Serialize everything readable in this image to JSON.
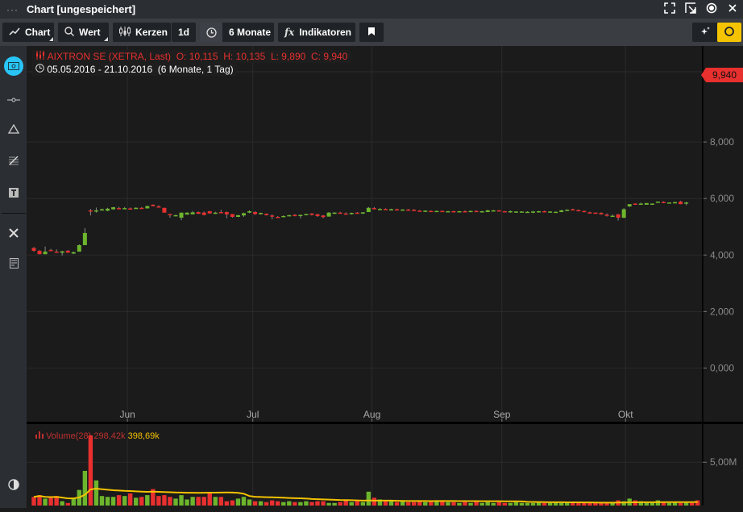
{
  "window": {
    "title": "Chart [ungespeichert]",
    "menu_icon": "ellipsis-icon"
  },
  "toolbar": {
    "chart": "Chart",
    "wert": "Wert",
    "kerzen": "Kerzen",
    "interval": "1d",
    "range": "6 Monate",
    "indikatoren": "Indikatoren"
  },
  "legend": {
    "instrument": "AIXTRON SE (XETRA, Last)",
    "open": "O: 10,115",
    "high": "H: 10,135",
    "low": "L: 9,890",
    "close": "C: 9,940",
    "daterange": "05.05.2016 - 21.10.2016",
    "span": "(6 Monate, 1 Tag)"
  },
  "price_label": "9,940",
  "volume_legend": {
    "name": "Volume(28)",
    "value": "298,42k",
    "ma": "398,69k"
  },
  "colors": {
    "up": "#6cb52d",
    "down": "#e8302f",
    "accent": "#f5c400",
    "active": "#29c5f6",
    "ma": "#f2c200"
  },
  "chart_data": {
    "type": "candlestick",
    "x_labels": [
      {
        "label": "Jun",
        "index": 16.5
      },
      {
        "label": "Jul",
        "index": 38.6
      },
      {
        "label": "Aug",
        "index": 59.6
      },
      {
        "label": "Sep",
        "index": 82.5
      },
      {
        "label": "Okt",
        "index": 104.3
      }
    ],
    "y_ticks": [
      "8,000",
      "6,000",
      "4,000",
      "2,000",
      "0,000"
    ],
    "y_tick_values": [
      8,
      6,
      4,
      2,
      0
    ],
    "ylim": [
      -1.9,
      11.4
    ],
    "volume_ticks": [
      "5,00M"
    ],
    "volume_tick_values": [
      5
    ],
    "volume_ylim": [
      0,
      9.3
    ],
    "ma_period": 28,
    "ohlc": [
      [
        4.25,
        4.28,
        4.12,
        4.15
      ],
      [
        4.15,
        4.17,
        4.03,
        4.03
      ],
      [
        4.03,
        4.3,
        4.03,
        4.12
      ],
      [
        4.18,
        4.22,
        4.14,
        4.15
      ],
      [
        4.12,
        4.2,
        4.1,
        4.11
      ],
      [
        4.08,
        4.15,
        3.98,
        4.13
      ],
      [
        4.15,
        4.18,
        4.08,
        4.08
      ],
      [
        4.05,
        4.12,
        4.04,
        4.1
      ],
      [
        4.12,
        4.38,
        4.12,
        4.35
      ],
      [
        4.35,
        4.95,
        4.35,
        4.78
      ],
      [
        5.58,
        5.63,
        5.4,
        5.55
      ],
      [
        5.55,
        5.68,
        5.5,
        5.58
      ],
      [
        5.58,
        5.64,
        5.57,
        5.62
      ],
      [
        5.57,
        5.67,
        5.55,
        5.64
      ],
      [
        5.62,
        5.7,
        5.6,
        5.69
      ],
      [
        5.66,
        5.71,
        5.64,
        5.65
      ],
      [
        5.65,
        5.7,
        5.64,
        5.66
      ],
      [
        5.65,
        5.68,
        5.63,
        5.64
      ],
      [
        5.66,
        5.69,
        5.65,
        5.67
      ],
      [
        5.67,
        5.7,
        5.66,
        5.66
      ],
      [
        5.65,
        5.75,
        5.65,
        5.73
      ],
      [
        5.78,
        5.79,
        5.72,
        5.73
      ],
      [
        5.72,
        5.76,
        5.69,
        5.7
      ],
      [
        5.67,
        5.67,
        5.5,
        5.5
      ],
      [
        5.45,
        5.46,
        5.32,
        5.42
      ],
      [
        5.4,
        5.43,
        5.39,
        5.41
      ],
      [
        5.32,
        5.45,
        5.23,
        5.5
      ],
      [
        5.43,
        5.51,
        5.43,
        5.5
      ],
      [
        5.44,
        5.56,
        5.44,
        5.51
      ],
      [
        5.52,
        5.54,
        5.45,
        5.46
      ],
      [
        5.5,
        5.54,
        5.4,
        5.42
      ],
      [
        5.55,
        5.56,
        5.47,
        5.47
      ],
      [
        5.47,
        5.53,
        5.45,
        5.5
      ],
      [
        5.52,
        5.6,
        5.5,
        5.5
      ],
      [
        5.52,
        5.54,
        5.3,
        5.44
      ],
      [
        5.45,
        5.45,
        5.32,
        5.35
      ],
      [
        5.35,
        5.42,
        5.34,
        5.41
      ],
      [
        5.4,
        5.5,
        5.35,
        5.48
      ],
      [
        5.5,
        5.58,
        5.48,
        5.55
      ],
      [
        5.52,
        5.55,
        5.42,
        5.45
      ],
      [
        5.45,
        5.5,
        5.43,
        5.49
      ],
      [
        5.46,
        5.47,
        5.4,
        5.41
      ],
      [
        5.4,
        5.44,
        5.26,
        5.36
      ],
      [
        5.35,
        5.38,
        5.33,
        5.34
      ],
      [
        5.36,
        5.4,
        5.34,
        5.38
      ],
      [
        5.4,
        5.42,
        5.39,
        5.41
      ],
      [
        5.42,
        5.45,
        5.37,
        5.39
      ],
      [
        5.38,
        5.43,
        5.3,
        5.42
      ],
      [
        5.44,
        5.46,
        5.42,
        5.45
      ],
      [
        5.47,
        5.48,
        5.4,
        5.42
      ],
      [
        5.44,
        5.46,
        5.35,
        5.38
      ],
      [
        5.4,
        5.42,
        5.3,
        5.34
      ],
      [
        5.36,
        5.52,
        5.36,
        5.5
      ],
      [
        5.48,
        5.52,
        5.46,
        5.5
      ],
      [
        5.5,
        5.53,
        5.47,
        5.49
      ],
      [
        5.47,
        5.51,
        5.44,
        5.46
      ],
      [
        5.46,
        5.5,
        5.43,
        5.49
      ],
      [
        5.5,
        5.52,
        5.46,
        5.48
      ],
      [
        5.47,
        5.52,
        5.45,
        5.51
      ],
      [
        5.52,
        5.7,
        5.52,
        5.67
      ],
      [
        5.66,
        5.7,
        5.62,
        5.64
      ],
      [
        5.62,
        5.66,
        5.59,
        5.63
      ],
      [
        5.63,
        5.65,
        5.6,
        5.61
      ],
      [
        5.61,
        5.64,
        5.59,
        5.62
      ],
      [
        5.62,
        5.64,
        5.58,
        5.59
      ],
      [
        5.6,
        5.62,
        5.58,
        5.61
      ],
      [
        5.61,
        5.63,
        5.59,
        5.6
      ],
      [
        5.6,
        5.62,
        5.56,
        5.57
      ],
      [
        5.57,
        5.59,
        5.54,
        5.56
      ],
      [
        5.53,
        5.58,
        5.52,
        5.57
      ],
      [
        5.56,
        5.58,
        5.53,
        5.54
      ],
      [
        5.53,
        5.57,
        5.52,
        5.56
      ],
      [
        5.56,
        5.57,
        5.53,
        5.54
      ],
      [
        5.53,
        5.56,
        5.52,
        5.55
      ],
      [
        5.55,
        5.57,
        5.52,
        5.53
      ],
      [
        5.52,
        5.56,
        5.51,
        5.55
      ],
      [
        5.55,
        5.58,
        5.53,
        5.54
      ],
      [
        5.53,
        5.57,
        5.52,
        5.56
      ],
      [
        5.56,
        5.58,
        5.53,
        5.53
      ],
      [
        5.53,
        5.56,
        5.5,
        5.55
      ],
      [
        5.52,
        5.6,
        5.52,
        5.58
      ],
      [
        5.57,
        5.6,
        5.55,
        5.58
      ],
      [
        5.58,
        5.59,
        5.55,
        5.56
      ],
      [
        5.55,
        5.56,
        5.52,
        5.53
      ],
      [
        5.52,
        5.58,
        5.5,
        5.55
      ],
      [
        5.54,
        5.55,
        5.52,
        5.54
      ],
      [
        5.53,
        5.55,
        5.51,
        5.54
      ],
      [
        5.52,
        5.55,
        5.51,
        5.53
      ],
      [
        5.51,
        5.56,
        5.48,
        5.54
      ],
      [
        5.52,
        5.56,
        5.5,
        5.55
      ],
      [
        5.55,
        5.57,
        5.52,
        5.53
      ],
      [
        5.52,
        5.55,
        5.51,
        5.54
      ],
      [
        5.53,
        5.54,
        5.52,
        5.53
      ],
      [
        5.52,
        5.6,
        5.52,
        5.58
      ],
      [
        5.57,
        5.62,
        5.56,
        5.6
      ],
      [
        5.62,
        5.64,
        5.58,
        5.59
      ],
      [
        5.59,
        5.61,
        5.55,
        5.56
      ],
      [
        5.56,
        5.57,
        5.51,
        5.52
      ],
      [
        5.51,
        5.53,
        5.49,
        5.5
      ],
      [
        5.5,
        5.51,
        5.48,
        5.49
      ],
      [
        5.49,
        5.51,
        5.43,
        5.44
      ],
      [
        5.43,
        5.47,
        5.36,
        5.39
      ],
      [
        5.38,
        5.44,
        5.36,
        5.39
      ],
      [
        5.44,
        5.45,
        5.22,
        5.32
      ],
      [
        5.32,
        5.66,
        5.3,
        5.62
      ],
      [
        5.72,
        5.8,
        5.7,
        5.8
      ],
      [
        5.82,
        5.83,
        5.8,
        5.81
      ],
      [
        5.82,
        5.86,
        5.81,
        5.82
      ],
      [
        5.78,
        5.84,
        5.78,
        5.84
      ],
      [
        5.82,
        5.83,
        5.81,
        5.82
      ],
      [
        5.86,
        5.89,
        5.84,
        5.89
      ],
      [
        5.88,
        5.9,
        5.85,
        5.86
      ],
      [
        5.83,
        5.86,
        5.82,
        5.86
      ],
      [
        5.84,
        5.89,
        5.83,
        5.87
      ],
      [
        5.89,
        5.92,
        5.8,
        5.8
      ],
      [
        5.85,
        5.88,
        5.76,
        5.86
      ]
    ],
    "volume_m": [
      1.0,
      1.2,
      0.8,
      0.9,
      1.1,
      0.5,
      0.3,
      0.8,
      1.8,
      4.0,
      8.1,
      2.9,
      1.1,
      1.0,
      1.0,
      1.2,
      1.1,
      1.4,
      0.9,
      1.0,
      1.2,
      1.9,
      1.1,
      1.2,
      1.0,
      0.8,
      1.2,
      0.7,
      1.0,
      1.0,
      1.0,
      1.4,
      1.0,
      1.0,
      0.5,
      0.6,
      0.8,
      1.0,
      0.7,
      0.5,
      0.5,
      0.4,
      0.6,
      0.5,
      0.4,
      0.5,
      0.4,
      0.4,
      0.5,
      0.4,
      0.5,
      0.5,
      0.3,
      0.3,
      0.4,
      0.6,
      0.4,
      0.5,
      0.4,
      1.6,
      0.9,
      0.7,
      0.5,
      0.6,
      0.4,
      0.5,
      0.4,
      0.4,
      0.5,
      0.4,
      0.5,
      0.6,
      0.5,
      0.4,
      0.4,
      0.3,
      0.4,
      0.3,
      0.5,
      0.3,
      0.4,
      0.3,
      0.4,
      0.3,
      0.3,
      0.4,
      0.3,
      0.3,
      0.3,
      0.4,
      0.3,
      0.3,
      0.4,
      0.3,
      0.3,
      0.3,
      0.4,
      0.3,
      0.3,
      0.3,
      0.4,
      0.3,
      0.3,
      0.6,
      0.5,
      0.8,
      0.6,
      0.5,
      0.4,
      0.4,
      0.6,
      0.4,
      0.3,
      0.4,
      0.3,
      0.4,
      0.3,
      0.6
    ]
  }
}
